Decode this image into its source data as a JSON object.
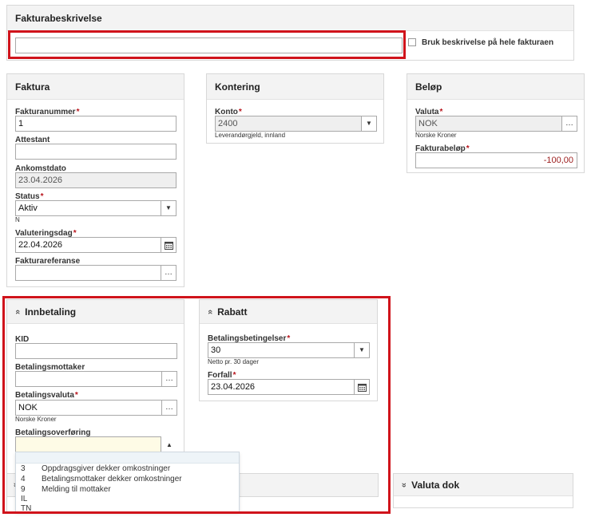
{
  "fakturabeskrivelse": {
    "title": "Fakturabeskrivelse",
    "input_value": "",
    "checkbox_label": "Bruk beskrivelse på hele fakturaen"
  },
  "faktura": {
    "title": "Faktura",
    "fakturanummer_label": "Fakturanummer",
    "fakturanummer_value": "1",
    "attestant_label": "Attestant",
    "attestant_value": "",
    "ankomstdato_label": "Ankomstdato",
    "ankomstdato_value": "23.04.2026",
    "status_label": "Status",
    "status_value": "Aktiv",
    "status_sub": "N",
    "valuteringsdag_label": "Valuteringsdag",
    "valuteringsdag_value": "22.04.2026",
    "fakturareferanse_label": "Fakturareferanse",
    "fakturareferanse_value": ""
  },
  "kontering": {
    "title": "Kontering",
    "konto_label": "Konto",
    "konto_value": "2400",
    "konto_sub": "Leverandørgjeld, innland"
  },
  "belop": {
    "title": "Beløp",
    "valuta_label": "Valuta",
    "valuta_value": "NOK",
    "valuta_sub": "Norske Kroner",
    "fakturabelop_label": "Fakturabeløp",
    "fakturabelop_value": "-100,00"
  },
  "innbetaling": {
    "title": "Innbetaling",
    "kid_label": "KID",
    "kid_value": "",
    "mottaker_label": "Betalingsmottaker",
    "mottaker_value": "",
    "valuta_label": "Betalingsvaluta",
    "valuta_value": "NOK",
    "valuta_sub": "Norske Kroner",
    "overforing_label": "Betalingsoverføring",
    "overforing_value": "",
    "options": [
      {
        "code": "3",
        "text": "Oppdragsgiver dekker omkostninger"
      },
      {
        "code": "4",
        "text": "Betalingsmottaker dekker omkostninger"
      },
      {
        "code": "9",
        "text": "Melding til mottaker"
      },
      {
        "code": "IL",
        "text": ""
      },
      {
        "code": "TN",
        "text": ""
      }
    ]
  },
  "rabatt": {
    "title": "Rabatt",
    "betingelser_label": "Betalingsbetingelser",
    "betingelser_value": "30",
    "betingelser_sub": "Netto pr. 30 dager",
    "forfall_label": "Forfall",
    "forfall_value": "23.04.2026"
  },
  "valuta_dok": {
    "title": "Valuta dok"
  },
  "icons": {
    "ellipsis": "…",
    "dropdown": "▼",
    "dropup": "▲",
    "collapse": "«"
  },
  "colors": {
    "required": "#b8141c",
    "highlight_border": "#d0131b",
    "negative_amount": "#9b1c1c"
  }
}
